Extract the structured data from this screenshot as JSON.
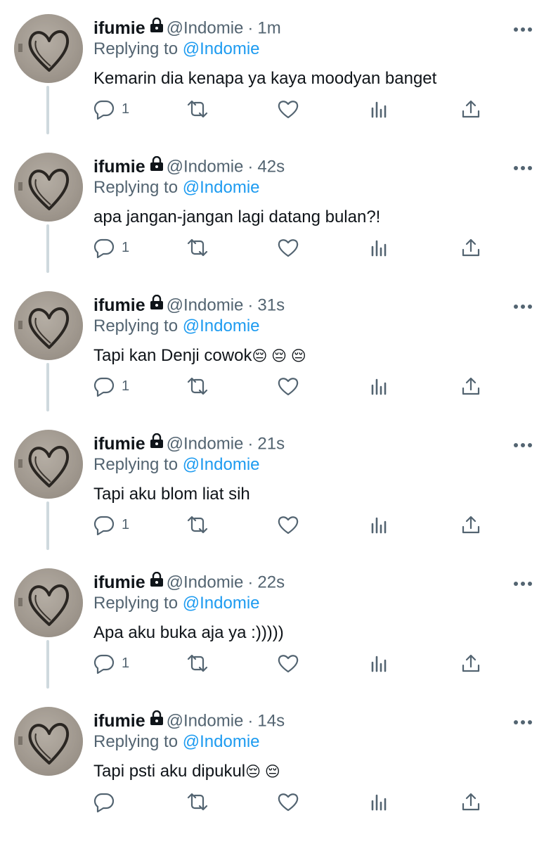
{
  "tweets": [
    {
      "name": "ifumie",
      "handle": "@Indomie",
      "time": "1m",
      "replying_prefix": "Replying to ",
      "replying_handle": "@Indomie",
      "text": "Kemarin dia kenapa ya kaya moodyan banget",
      "emoji": "",
      "reply_count": "1"
    },
    {
      "name": "ifumie",
      "handle": "@Indomie",
      "time": "42s",
      "replying_prefix": "Replying to ",
      "replying_handle": "@Indomie",
      "text": "apa jangan-jangan lagi datang bulan?!",
      "emoji": "",
      "reply_count": "1"
    },
    {
      "name": "ifumie",
      "handle": "@Indomie",
      "time": "31s",
      "replying_prefix": "Replying to ",
      "replying_handle": "@Indomie",
      "text": "Tapi kan Denji cowok",
      "emoji": "😔 😔 😔",
      "reply_count": "1"
    },
    {
      "name": "ifumie",
      "handle": "@Indomie",
      "time": "21s",
      "replying_prefix": "Replying to ",
      "replying_handle": "@Indomie",
      "text": "Tapi aku blom liat sih",
      "emoji": "",
      "reply_count": "1"
    },
    {
      "name": "ifumie",
      "handle": "@Indomie",
      "time": "22s",
      "replying_prefix": "Replying to ",
      "replying_handle": "@Indomie",
      "text": "Apa aku buka aja ya :)))))",
      "emoji": "",
      "reply_count": "1"
    },
    {
      "name": "ifumie",
      "handle": "@Indomie",
      "time": "14s",
      "replying_prefix": "Replying to ",
      "replying_handle": "@Indomie",
      "text": "Tapi psti aku dipukul",
      "emoji": "😔 😔",
      "reply_count": ""
    }
  ],
  "colors": {
    "text": "#0f1419",
    "secondary": "#536471",
    "accent": "#1d9bf0",
    "thread_line": "#cfd9de"
  },
  "icons": [
    "lock-icon",
    "more-icon",
    "reply-icon",
    "retweet-icon",
    "like-icon",
    "analytics-icon",
    "share-icon"
  ]
}
